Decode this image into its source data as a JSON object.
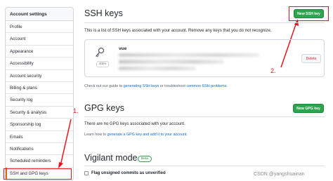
{
  "sidebar": {
    "header": "Account settings",
    "items": [
      {
        "label": "Profile"
      },
      {
        "label": "Account"
      },
      {
        "label": "Appearance"
      },
      {
        "label": "Accessibility"
      },
      {
        "label": "Account security"
      },
      {
        "label": "Billing & plans"
      },
      {
        "label": "Security log"
      },
      {
        "label": "Security & analysis"
      },
      {
        "label": "Sponsorship log"
      },
      {
        "label": "Emails"
      },
      {
        "label": "Notifications"
      },
      {
        "label": "Scheduled reminders"
      },
      {
        "label": "SSH and GPG keys",
        "selected": true
      }
    ]
  },
  "ssh": {
    "title": "SSH keys",
    "new_button": "New SSH key",
    "description": "This is a list of SSH keys associated with your account. Remove any keys that you do not recognize.",
    "key": {
      "name": "vue",
      "type_badge": "SSH",
      "delete_label": "Delete"
    },
    "guide_prefix": "Check out our guide to ",
    "guide_link1": "generating SSH keys",
    "guide_mid": " or troubleshoot ",
    "guide_link2": "common SSH problems",
    "guide_suffix": "."
  },
  "gpg": {
    "title": "GPG keys",
    "new_button": "New GPG key",
    "description": "There are no GPG keys associated with your account.",
    "learn_prefix": "Learn how to ",
    "learn_link": "generate a GPG key and add it to your account",
    "learn_suffix": "."
  },
  "vigilant": {
    "title": "Vigilant mode",
    "badge": "Beta",
    "checkbox_label": "Flag unsigned commits as unverified"
  },
  "annotations": {
    "step1": "1.",
    "step2": "2."
  },
  "watermark": "CSDN @yangshuainan",
  "colors": {
    "accent_green": "#2da44e",
    "annotation_red": "#e8141c",
    "link_blue": "#0969da",
    "selected_border": "#e36209"
  }
}
